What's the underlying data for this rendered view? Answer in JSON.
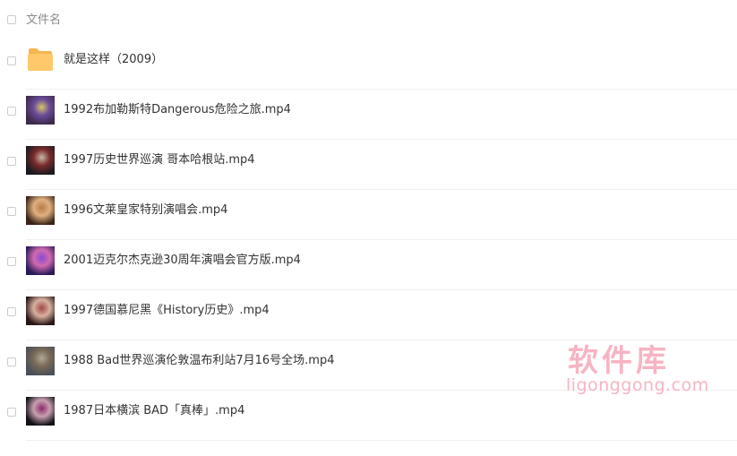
{
  "header": {
    "column_label": "文件名"
  },
  "files": [
    {
      "name": "就是这样（2009）",
      "type": "folder",
      "icon": "folder-icon",
      "color": "#ffc86b"
    },
    {
      "name": "1992布加勒斯特Dangerous危险之旅.mp4",
      "type": "video",
      "icon": "video-thumbnail",
      "colors": [
        "#3d2a4a",
        "#d8c66a",
        "#6a4c9a"
      ]
    },
    {
      "name": "1997历史世界巡演 哥本哈根站.mp4",
      "type": "video",
      "icon": "video-thumbnail",
      "colors": [
        "#1a1a1f",
        "#c8b8a8",
        "#7a2c2c"
      ]
    },
    {
      "name": "1996文莱皇家特别演唱会.mp4",
      "type": "video",
      "icon": "video-thumbnail",
      "colors": [
        "#3a2418",
        "#b87a4a",
        "#e0b080"
      ]
    },
    {
      "name": "2001迈克尔杰克逊30周年演唱会官方版.mp4",
      "type": "video",
      "icon": "video-thumbnail",
      "colors": [
        "#2a1a5a",
        "#8a4ad0",
        "#d06ab0"
      ]
    },
    {
      "name": "1997德国慕尼黑《History历史》.mp4",
      "type": "video",
      "icon": "video-thumbnail",
      "colors": [
        "#2a1616",
        "#a04848",
        "#d8b0a0"
      ]
    },
    {
      "name": "1988 Bad世界巡演伦敦温布利站7月16号全场.mp4",
      "type": "video",
      "icon": "video-thumbnail",
      "colors": [
        "#4a5058",
        "#b0a898",
        "#7a6a58"
      ]
    },
    {
      "name": "1987日本横滨 BAD「真棒」.mp4",
      "type": "video",
      "icon": "video-thumbnail",
      "colors": [
        "#121018",
        "#8a2a6a",
        "#c8a0b0"
      ]
    }
  ],
  "watermark": {
    "title": "软件库",
    "subtitle": "ligonggong.com"
  }
}
